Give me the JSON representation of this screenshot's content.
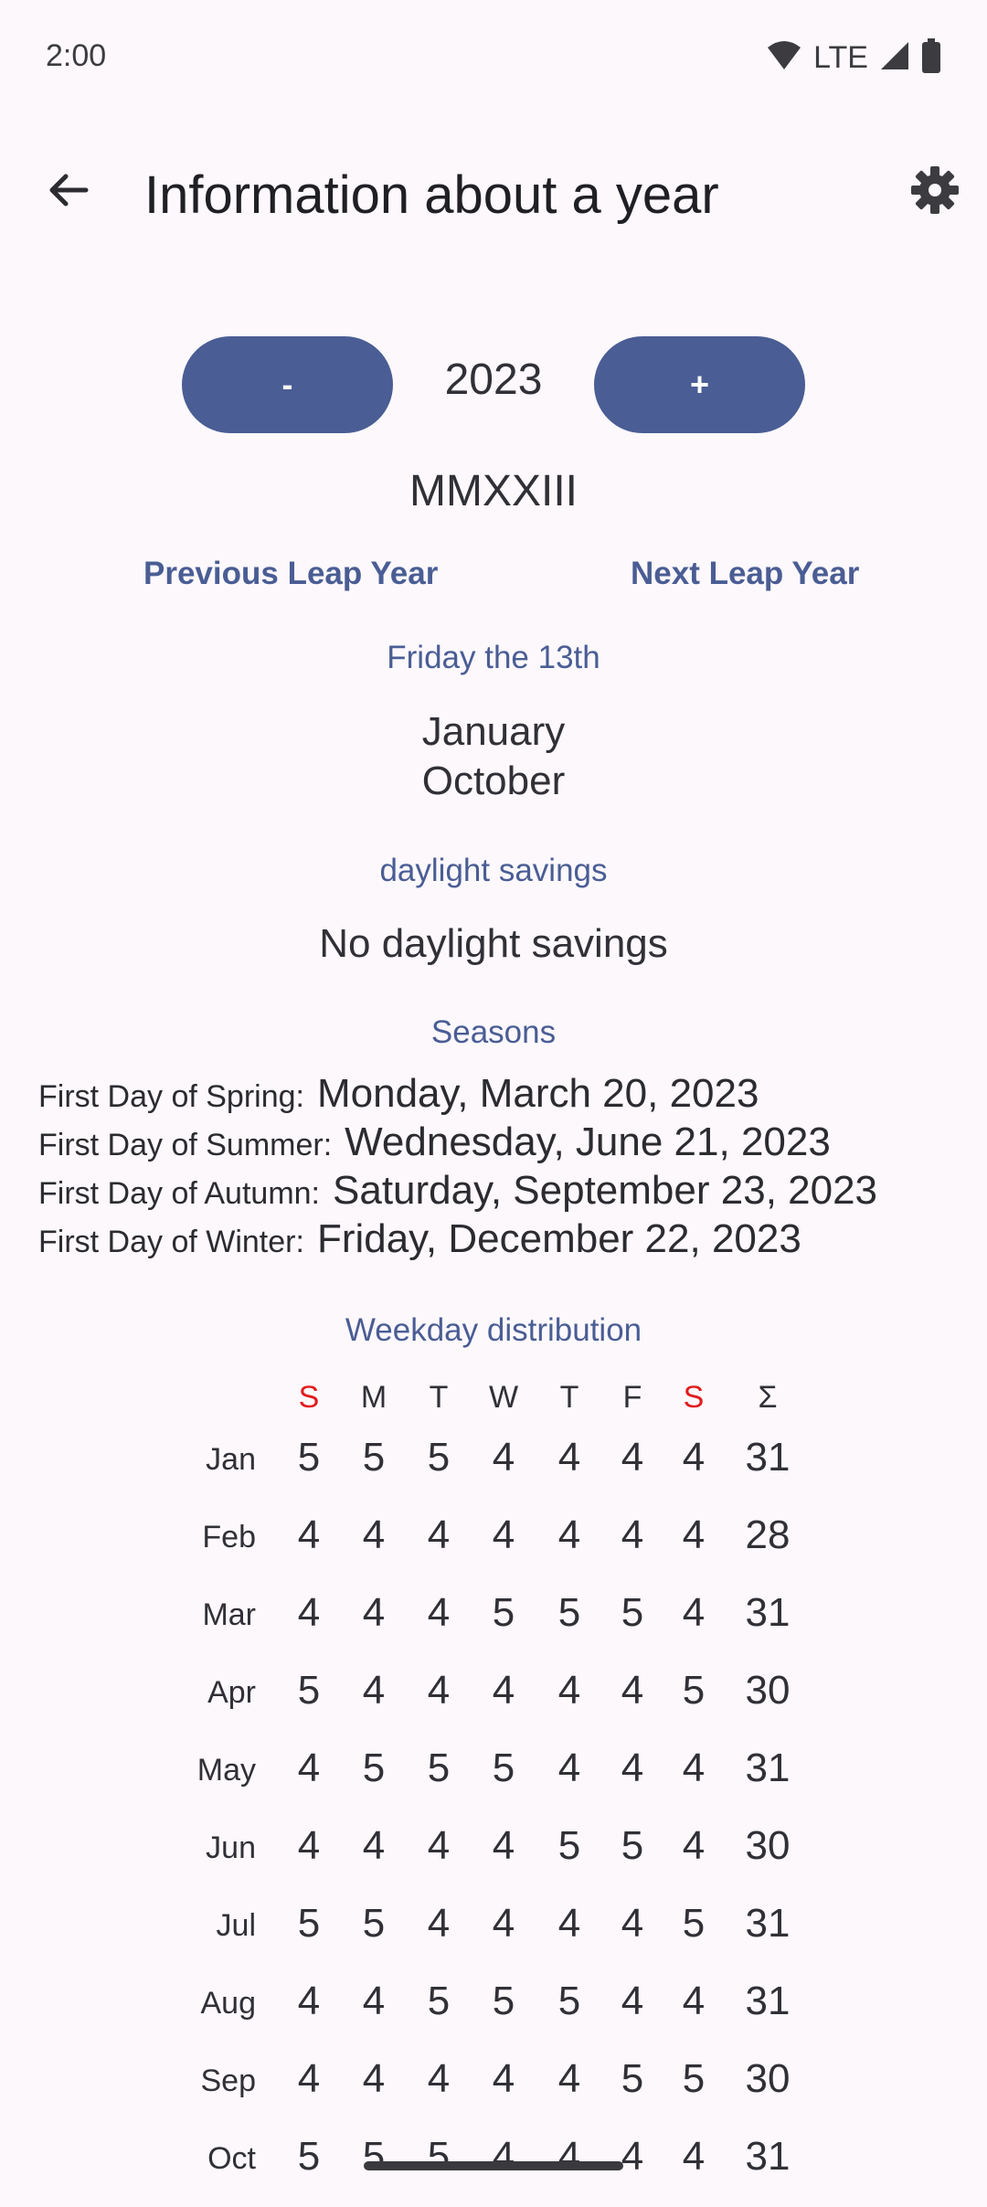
{
  "status_bar": {
    "time": "2:00",
    "network": "LTE"
  },
  "appbar": {
    "title": "Information about a year"
  },
  "year_selector": {
    "minus_label": "-",
    "plus_label": "+",
    "year": "2023"
  },
  "roman_numeral": "MMXXIII",
  "leap_links": {
    "previous": "Previous Leap Year",
    "next": "Next Leap Year"
  },
  "friday_13th": {
    "heading": "Friday the 13th",
    "months": [
      "January",
      "October"
    ]
  },
  "daylight_savings": {
    "heading": "daylight savings",
    "value": "No daylight savings"
  },
  "seasons": {
    "heading": "Seasons",
    "rows": [
      {
        "label": "First Day of Spring:",
        "date": "Monday, March 20, 2023"
      },
      {
        "label": "First Day of Summer:",
        "date": "Wednesday, June 21, 2023"
      },
      {
        "label": "First Day of Autumn:",
        "date": "Saturday, September 23, 2023"
      },
      {
        "label": "First Day of Winter:",
        "date": "Friday, December 22, 2023"
      }
    ]
  },
  "weekday_distribution": {
    "heading": "Weekday distribution",
    "headers": [
      "S",
      "M",
      "T",
      "W",
      "T",
      "F",
      "S",
      "Σ"
    ],
    "weekend_color": "#e11b1b",
    "rows": [
      {
        "month": "Jan",
        "values": [
          "5",
          "5",
          "5",
          "4",
          "4",
          "4",
          "4",
          "31"
        ]
      },
      {
        "month": "Feb",
        "values": [
          "4",
          "4",
          "4",
          "4",
          "4",
          "4",
          "4",
          "28"
        ]
      },
      {
        "month": "Mar",
        "values": [
          "4",
          "4",
          "4",
          "5",
          "5",
          "5",
          "4",
          "31"
        ]
      },
      {
        "month": "Apr",
        "values": [
          "5",
          "4",
          "4",
          "4",
          "4",
          "4",
          "5",
          "30"
        ]
      },
      {
        "month": "May",
        "values": [
          "4",
          "5",
          "5",
          "5",
          "4",
          "4",
          "4",
          "31"
        ]
      },
      {
        "month": "Jun",
        "values": [
          "4",
          "4",
          "4",
          "4",
          "5",
          "5",
          "4",
          "30"
        ]
      },
      {
        "month": "Jul",
        "values": [
          "5",
          "5",
          "4",
          "4",
          "4",
          "4",
          "5",
          "31"
        ]
      },
      {
        "month": "Aug",
        "values": [
          "4",
          "4",
          "5",
          "5",
          "5",
          "4",
          "4",
          "31"
        ]
      },
      {
        "month": "Sep",
        "values": [
          "4",
          "4",
          "4",
          "4",
          "4",
          "5",
          "5",
          "30"
        ]
      },
      {
        "month": "Oct",
        "values": [
          "5",
          "5",
          "5",
          "4",
          "4",
          "4",
          "4",
          "31"
        ]
      }
    ]
  },
  "colors": {
    "accent": "#4a5d94",
    "background": "#fcf8fc",
    "text": "#303036"
  }
}
